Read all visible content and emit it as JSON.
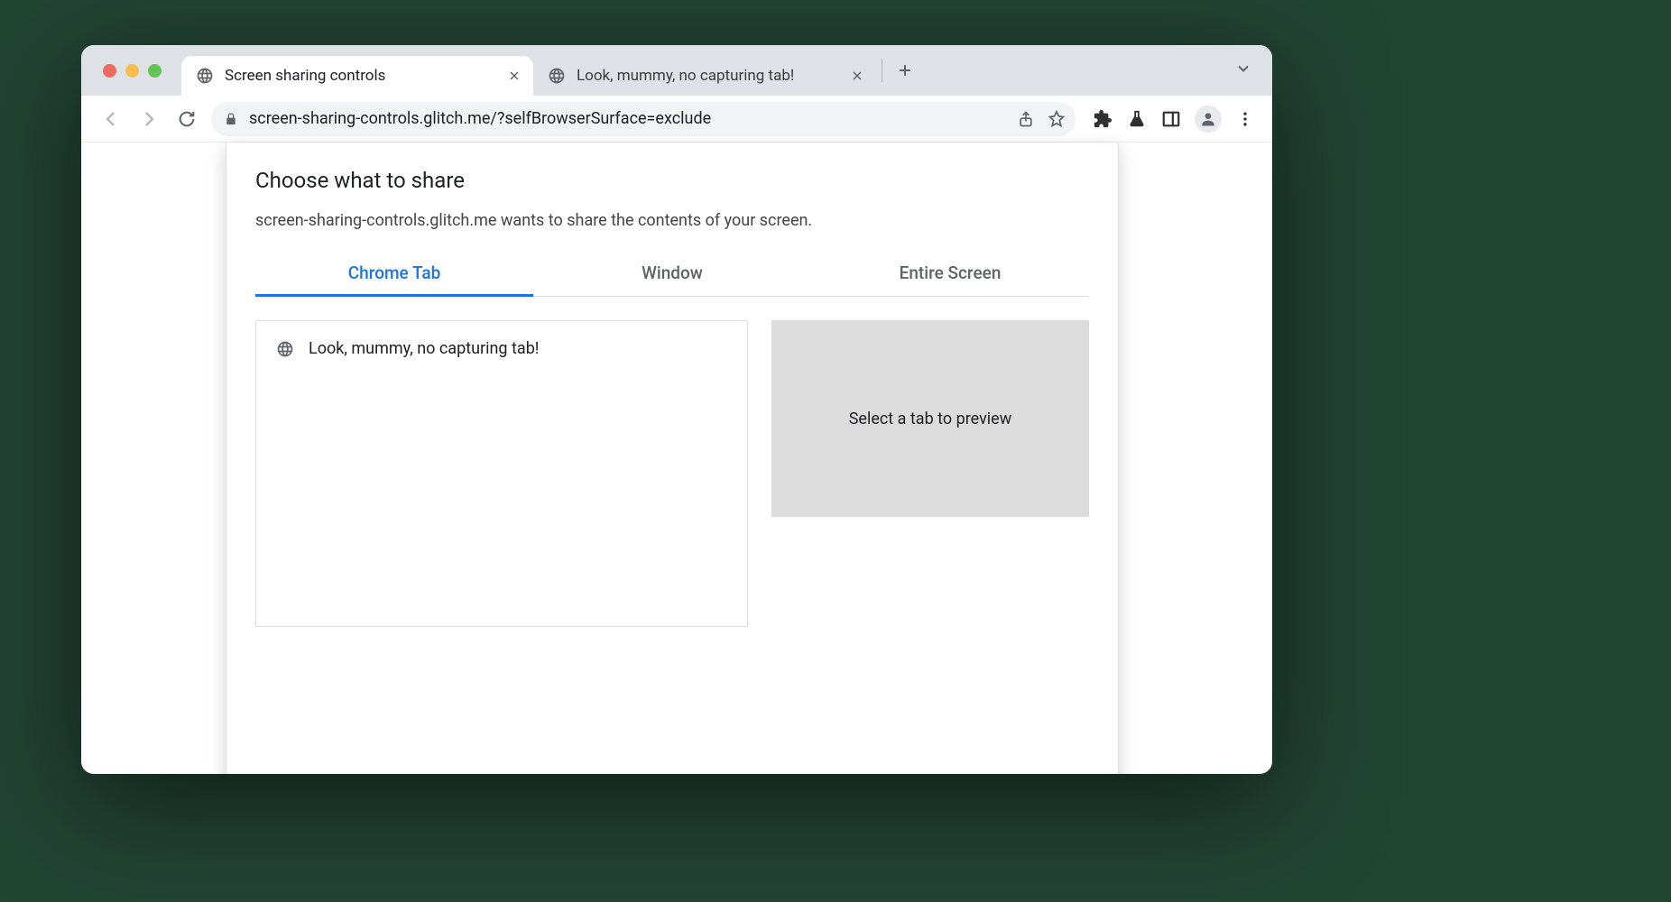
{
  "browser": {
    "tabs": [
      {
        "title": "Screen sharing controls",
        "active": true
      },
      {
        "title": "Look, mummy, no capturing tab!",
        "active": false
      }
    ],
    "url": "screen-sharing-controls.glitch.me/?selfBrowserSurface=exclude"
  },
  "dialog": {
    "title": "Choose what to share",
    "subtitle": "screen-sharing-controls.glitch.me wants to share the contents of your screen.",
    "tabs": {
      "chrome_tab": "Chrome Tab",
      "window": "Window",
      "entire_screen": "Entire Screen"
    },
    "list": [
      {
        "title": "Look, mummy, no capturing tab!"
      }
    ],
    "preview_placeholder": "Select a tab to preview"
  }
}
